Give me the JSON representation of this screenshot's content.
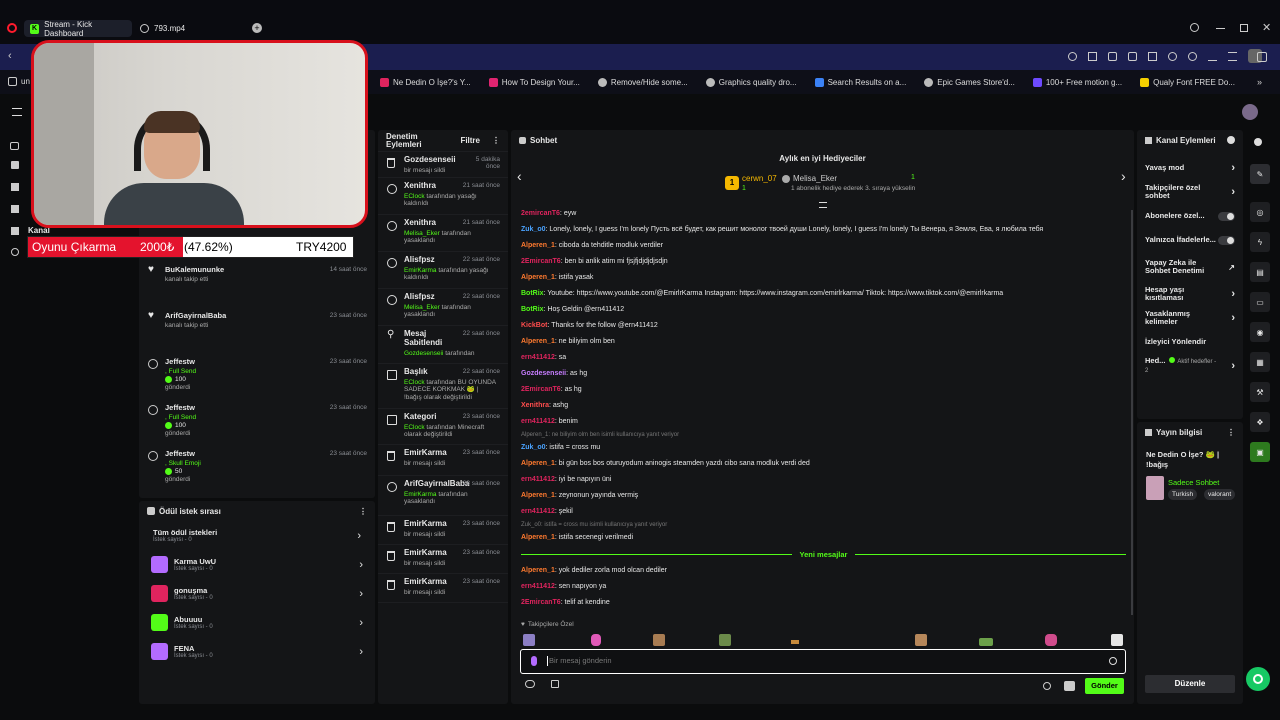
{
  "browser": {
    "tabs": [
      {
        "label": "Stream - Kick Dashboard"
      },
      {
        "label": "793.mp4"
      }
    ],
    "bookmarks": [
      "un",
      "Ne Dedin O İşe?'s Y...",
      "How To Design Your...",
      "Remove/Hide some...",
      "Graphics quality dro...",
      "Search Results on a...",
      "Epic Games Store'd...",
      "100+ Free motion g...",
      "Qualy Font FREE Do..."
    ]
  },
  "webcam_overlay": {
    "goal_text": "Oyunu Çıkarma",
    "goal_amount": "2000₺",
    "goal_percent": "(47.62%)",
    "goal_total": "TRY4200",
    "goal_progress": 0.4762
  },
  "left_nav": {
    "partial_label": "Kanal"
  },
  "activity_feed": [
    {
      "name": "BuKalemununke",
      "desc": "kanalı takip etti",
      "time": "14 saat önce",
      "type": "heart"
    },
    {
      "name": "ArifGayirnalBaba",
      "desc": "kanalı takip etti",
      "time": "23 saat önce",
      "type": "heart"
    },
    {
      "name": "Jeffestw",
      "desc": ", Full Send",
      "amount": "100",
      "desc2": "gönderdi",
      "time": "23 saat önce",
      "type": "kick"
    },
    {
      "name": "Jeffestw",
      "desc": ", Full Send",
      "amount": "100",
      "desc2": "gönderdi",
      "time": "23 saat önce",
      "type": "kick"
    },
    {
      "name": "Jeffestw",
      "desc": ", Skull Emoji",
      "amount": "50",
      "desc2": "gönderdi",
      "time": "23 saat önce",
      "type": "kick"
    }
  ],
  "reward_queue": {
    "title": "Ödül istek sırası",
    "all_label": "Tüm ödül istekleri",
    "all_count": "İstek sayısı - 0",
    "items": [
      {
        "name": "Karma UwU",
        "count": "İstek sayısı - 0",
        "color": "#b36bff"
      },
      {
        "name": "gonuşma",
        "count": "İstek sayısı - 0",
        "color": "#e0245e"
      },
      {
        "name": "Abuuuu",
        "count": "İstek sayısı - 0",
        "color": "#53fc18"
      },
      {
        "name": "FENA",
        "count": "İstek sayısı - 0",
        "color": "#b36bff"
      }
    ]
  },
  "mod_actions": {
    "title": "Denetim Eylemleri",
    "filter_label": "Filtre",
    "items": [
      {
        "name": "Gozdesenseii",
        "time": "5 dakika önce",
        "desc": "bir mesajı sildi",
        "icon": "trash"
      },
      {
        "name": "Xenithra",
        "time": "21 saat önce",
        "actor": "EClock",
        "desc": " tarafından yasağı kaldırıldı",
        "icon": "unban"
      },
      {
        "name": "Xenithra",
        "time": "21 saat önce",
        "actor": "Melisa_Eker",
        "desc": " tarafından yasaklandı",
        "icon": "ban"
      },
      {
        "name": "Alisfpsz",
        "time": "22 saat önce",
        "actor": "EmirKarma",
        "desc": " tarafından yasağı kaldırıldı",
        "icon": "unban"
      },
      {
        "name": "Alisfpsz",
        "time": "22 saat önce",
        "actor": "Melisa_Eker",
        "desc": " tarafından yasaklandı",
        "icon": "ban"
      },
      {
        "name": "Mesaj Sabitlendi",
        "time": "22 saat önce",
        "actor": "Gozdesenseii",
        "desc": " tarafından",
        "icon": "pin"
      },
      {
        "name": "Başlık",
        "time": "22 saat önce",
        "actor": "EClock",
        "desc": " tarafından BU OYUNDA SADECE KORKMAK 🐸 | !bağış olarak değiştirildi",
        "icon": "edit"
      },
      {
        "name": "Kategori",
        "time": "23 saat önce",
        "actor": "EClock",
        "desc": " tarafından Minecraft olarak değiştirildi",
        "icon": "edit"
      },
      {
        "name": "EmirKarma",
        "time": "23 saat önce",
        "desc": "bir mesajı sildi",
        "icon": "trash"
      },
      {
        "name": "ArifGayirnalBaba",
        "time": "23 saat önce",
        "actor": "EmirKarma",
        "desc": " tarafından yasaklandı",
        "icon": "ban"
      },
      {
        "name": "EmirKarma",
        "time": "23 saat önce",
        "desc": "bir mesajı sildi",
        "icon": "trash"
      },
      {
        "name": "EmirKarma",
        "time": "23 saat önce",
        "desc": "bir mesajı sildi",
        "icon": "trash"
      },
      {
        "name": "EmirKarma",
        "time": "23 saat önce",
        "desc": "bir mesajı sildi",
        "icon": "trash"
      }
    ]
  },
  "chat": {
    "title": "Sohbet",
    "gifter_title": "Aylık en iyi Hediyeciler",
    "top_gifter": "cerwn_07",
    "top_gifter_count": "1",
    "second_gifter": "Melisa_Eker",
    "second_gifter_count": "1",
    "gifter_note": "1 abonelik hediye ederek 3. sıraya yükselin",
    "messages": [
      {
        "user": "2emircanT6",
        "color": "#e0245e",
        "text": "eyw"
      },
      {
        "user": "Zuk_o0",
        "color": "#4aa3ff",
        "text": "Lonely, lonely, I guess I'm lonely  Пусть всё будет, как решит монолог твоей души  Lonely, lonely, I guess I'm lonely  Ты Венера, я Земля, Ева, я любила тебя"
      },
      {
        "user": "Alperen_1",
        "color": "#ff7a2f",
        "text": "ciboda da tehditle modluk verdiler"
      },
      {
        "user": "2EmircanT6",
        "color": "#e0245e",
        "text": "ben bi anlik atim mi fjsjfjdjdjdjsdjn"
      },
      {
        "user": "Alperen_1",
        "color": "#ff7a2f",
        "text": "istifa yasak"
      },
      {
        "user": "BotRix",
        "color": "#53fc18",
        "text": "Youtube: https://www.youtube.com/@EmirlrKarma Instagram: https://www.instagram.com/emirlrkarma/ Tiktok: https://www.tiktok.com/@emirlrkarma"
      },
      {
        "user": "BotRix",
        "color": "#53fc18",
        "text": "Hoş Geldin @ern411412"
      },
      {
        "user": "KickBot",
        "color": "#ff4d4d",
        "text": "Thanks for the follow @ern411412"
      },
      {
        "user": "Alperen_1",
        "color": "#ff7a2f",
        "text": "ne biliyim olm ben"
      },
      {
        "user": "ern411412",
        "color": "#e0245e",
        "text": "sa"
      },
      {
        "user": "Gozdesenseii",
        "color": "#c77dff",
        "text": "as hg"
      },
      {
        "user": "2EmircanT6",
        "color": "#e0245e",
        "text": "as hg"
      },
      {
        "user": "Xenithra",
        "color": "#ff4d4d",
        "text": "ashg"
      },
      {
        "user": "ern411412",
        "color": "#e0245e",
        "text": "benim"
      },
      {
        "reply": "Alperen_1: ne biliyim olm ben isimli kullanıcıya yanıt veriyor",
        "user": "Zuk_o0",
        "color": "#4aa3ff",
        "text": "istifa = cross mu"
      },
      {
        "user": "Alperen_1",
        "color": "#ff7a2f",
        "text": "bi gün bos bos oturuyodum aninogis steamden yazdı cibo sana modluk verdi ded"
      },
      {
        "user": "ern411412",
        "color": "#e0245e",
        "text": "iyi be napıyın üni"
      },
      {
        "user": "Alperen_1",
        "color": "#ff7a2f",
        "text": "zeynonun yayında vermiş"
      },
      {
        "user": "ern411412",
        "color": "#e0245e",
        "text": "şekil"
      },
      {
        "reply": "Zuk_o0: istifa = cross mu isimli kullanıcıya yanıt veriyor",
        "user": "Alperen_1",
        "color": "#ff7a2f",
        "text": "istifa secenegi verilmedi"
      }
    ],
    "new_messages_label": "Yeni mesajlar",
    "new_messages": [
      {
        "user": "Alperen_1",
        "color": "#ff7a2f",
        "text": "yok dediler zorla mod olcan dediler"
      },
      {
        "user": "ern411412",
        "color": "#e0245e",
        "text": "sen napıyon ya"
      },
      {
        "user": "2EmircanT6",
        "color": "#e0245e",
        "text": "telif at kendine"
      }
    ],
    "followers_only_label": "Takipçilere Özel",
    "input_placeholder": "Bir mesaj gönderin",
    "send_label": "Gönder"
  },
  "channel_actions": {
    "title": "Kanal Eylemleri",
    "items": [
      {
        "label": "Yavaş mod",
        "control": "chevron"
      },
      {
        "label": "Takipçilere özel sohbet",
        "control": "chevron"
      },
      {
        "label": "Abonelere özel...",
        "control": "toggle"
      },
      {
        "label": "Yalnızca İfadelerle...",
        "control": "toggle"
      },
      {
        "label": "Yapay Zeka ile Sohbet Denetimi",
        "control": "external"
      },
      {
        "label": "Hesap yaşı kısıtlaması",
        "control": "chevron"
      },
      {
        "label": "Yasaklanmış kelimeler",
        "control": "chevron"
      },
      {
        "label": "İzleyici Yönlendir",
        "control": "none"
      },
      {
        "label": "Hed...",
        "sub": "Aktif hedefler - 2",
        "control": "chevron"
      }
    ]
  },
  "stream_info": {
    "title": "Yayın bilgisi",
    "stream_title": "Ne Dedin O İşe? 🐸 | !bağış",
    "category": "Sadece Sohbet",
    "tags": [
      "Turkish",
      "valorant"
    ],
    "edit_label": "Düzenle"
  }
}
